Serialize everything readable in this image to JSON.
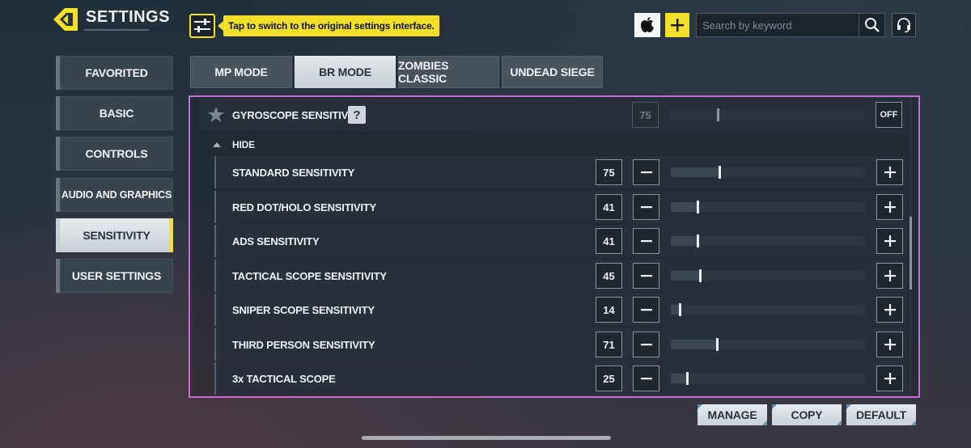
{
  "header": {
    "title": "SETTINGS",
    "switch_tooltip": "Tap to switch to the original settings interface.",
    "search_placeholder": "Search by keyword"
  },
  "nav": {
    "items": [
      {
        "label": "FAVORITED",
        "active": false
      },
      {
        "label": "BASIC",
        "active": false
      },
      {
        "label": "CONTROLS",
        "active": false
      },
      {
        "label": "AUDIO AND GRAPHICS",
        "active": false
      },
      {
        "label": "SENSITIVITY",
        "active": true
      },
      {
        "label": "USER SETTINGS",
        "active": false
      }
    ]
  },
  "mode_tabs": [
    {
      "label": "MP MODE",
      "active": false
    },
    {
      "label": "BR MODE",
      "active": true
    },
    {
      "label": "ZOMBIES CLASSIC",
      "active": false
    },
    {
      "label": "UNDEAD SIEGE",
      "active": false
    }
  ],
  "gyroscope": {
    "label": "GYROSCOPE SENSITIVITY",
    "help": "?",
    "value": 75,
    "toggle": "OFF"
  },
  "hide_label": "HIDE",
  "slider_max": 300,
  "sensitivity_rows": [
    {
      "label": "STANDARD SENSITIVITY",
      "value": 75
    },
    {
      "label": "RED DOT/HOLO SENSITIVITY",
      "value": 41
    },
    {
      "label": "ADS SENSITIVITY",
      "value": 41
    },
    {
      "label": "TACTICAL SCOPE SENSITIVITY",
      "value": 45
    },
    {
      "label": "SNIPER SCOPE SENSITIVITY",
      "value": 14
    },
    {
      "label": "THIRD PERSON SENSITIVITY",
      "value": 71
    },
    {
      "label": "3x TACTICAL SCOPE",
      "value": 25
    }
  ],
  "footer": {
    "manage": "MANAGE",
    "copy": "COPY",
    "default": "DEFAULT"
  },
  "colors": {
    "accent": "#f2df28",
    "panel_border": "#c86dd0",
    "active_tab": "#d5dbdf"
  },
  "icons": {
    "back": "back-arrow-icon",
    "switch": "sliders-icon",
    "apple": "apple-icon",
    "plus": "plus-icon",
    "search": "search-icon",
    "support": "headset-icon",
    "favorite": "star-icon",
    "collapse": "caret-up-icon"
  }
}
